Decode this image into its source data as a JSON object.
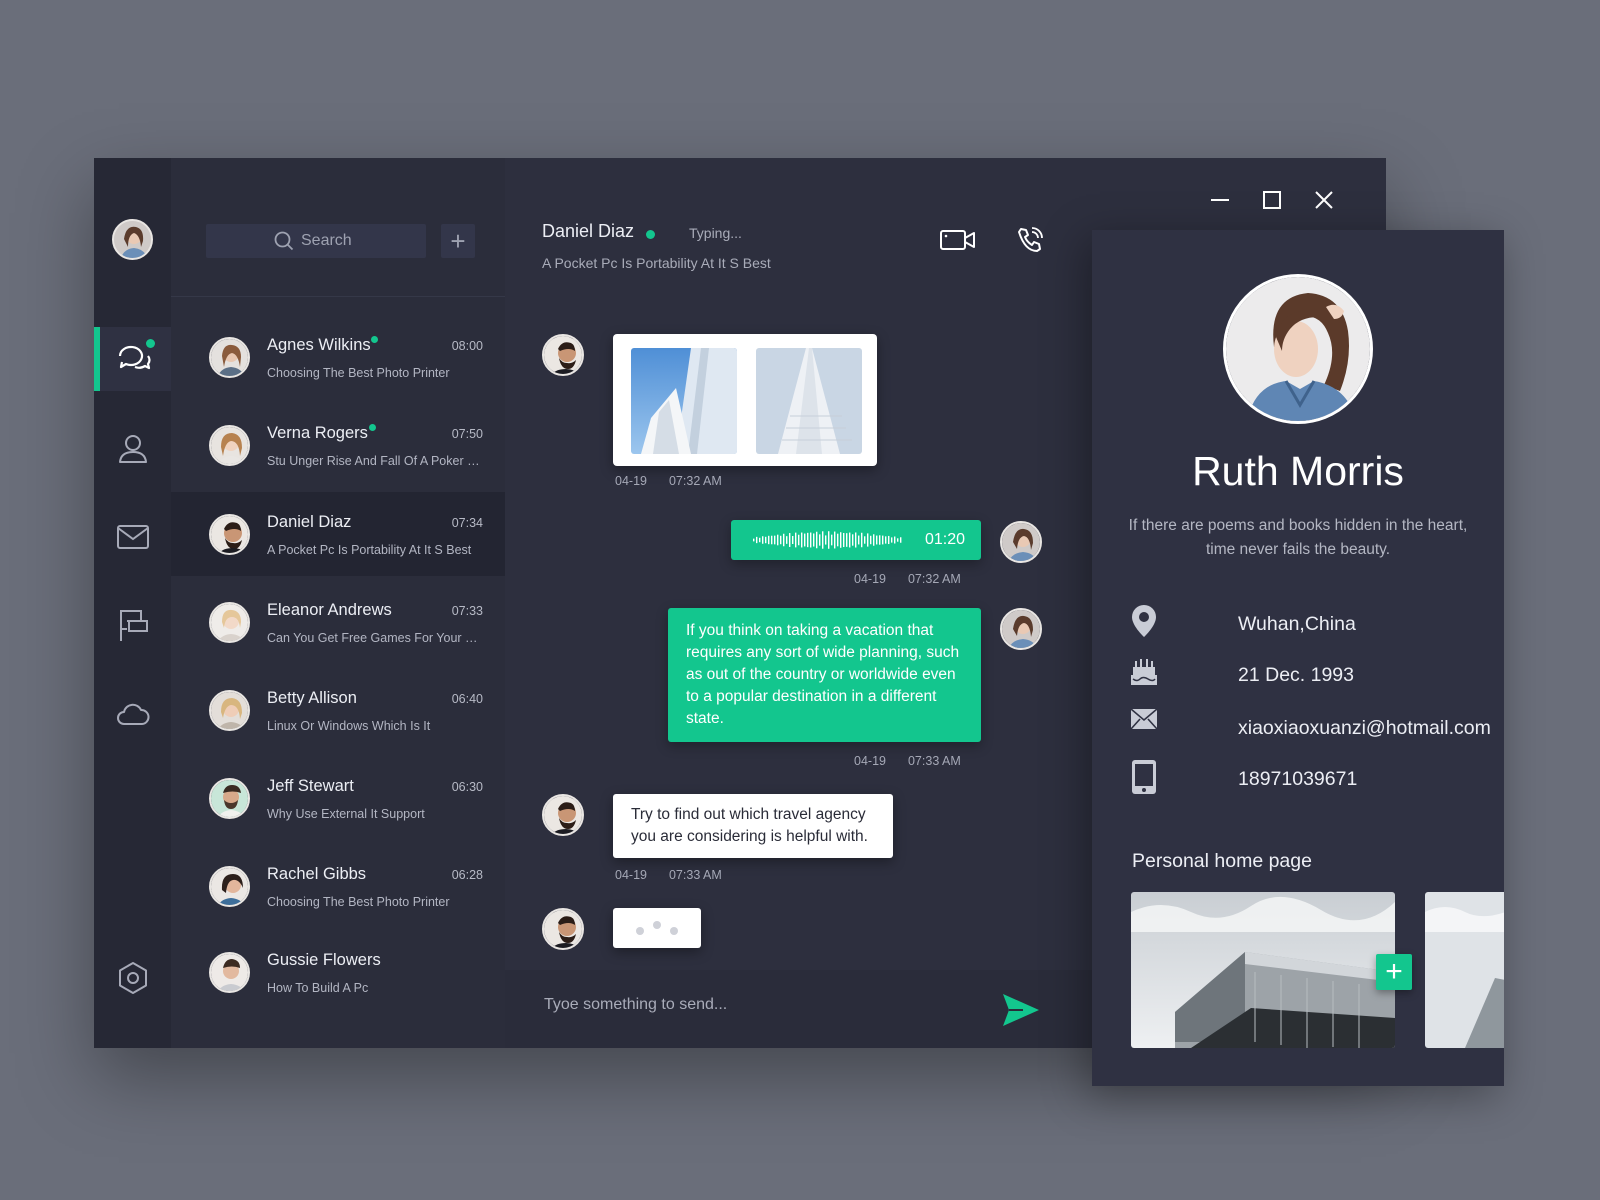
{
  "nav": {
    "items": [
      {
        "icon": "chat-bubbles-icon",
        "active": true,
        "has_badge": true
      },
      {
        "icon": "contacts-icon",
        "active": false
      },
      {
        "icon": "mail-icon",
        "active": false
      },
      {
        "icon": "flag-icon",
        "active": false
      },
      {
        "icon": "cloud-icon",
        "active": false
      }
    ],
    "settings_icon": "settings-hexagon-icon"
  },
  "search": {
    "placeholder": "Search"
  },
  "conversations": [
    {
      "name": "Agnes Wilkins",
      "time": "08:00",
      "preview": "Choosing The Best Photo Printer",
      "online": true,
      "avatar_color": "#c9b7a8"
    },
    {
      "name": "Verna Rogers",
      "time": "07:50",
      "preview": "Stu Unger Rise And Fall Of A Poker Playing Genius",
      "online": true,
      "avatar_color": "#d8c3b2"
    },
    {
      "name": "Daniel Diaz",
      "time": "07:34",
      "preview": "A Pocket Pc Is Portability At It S Best",
      "online": false,
      "active": true,
      "avatar_color": "#6a4a36"
    },
    {
      "name": "Eleanor Andrews",
      "time": "07:33",
      "preview": "Can You Get Free Games For Your Smartphone",
      "online": false,
      "avatar_color": "#e4d2c2"
    },
    {
      "name": "Betty Allison",
      "time": "06:40",
      "preview": "Linux Or Windows Which Is It",
      "online": false,
      "avatar_color": "#d5c0a4"
    },
    {
      "name": "Jeff Stewart",
      "time": "06:30",
      "preview": "Why Use External It Support",
      "online": false,
      "avatar_color": "#9e8a78"
    },
    {
      "name": "Rachel Gibbs",
      "time": "06:28",
      "preview": "Choosing The Best Photo Printer",
      "online": false,
      "avatar_color": "#4a3a36"
    },
    {
      "name": "Gussie Flowers",
      "time": "",
      "preview": "How To Build A Pc",
      "online": false,
      "avatar_color": "#a59384"
    }
  ],
  "chat": {
    "contact_name": "Daniel Diaz",
    "status": "Typing...",
    "subtitle": "A Pocket Pc Is Portability At It S Best",
    "messages": [
      {
        "kind": "images",
        "from": "contact",
        "date": "04-19",
        "time": "07:32  AM"
      },
      {
        "kind": "voice",
        "from": "me",
        "duration": "01:20",
        "date": "04-19",
        "time": "07:32  AM"
      },
      {
        "kind": "text",
        "from": "me",
        "text": "If you think on taking a vacation that requires any sort of wide planning, such as out of the country or worldwide even to a popular destination in a different state.",
        "date": "04-19",
        "time": "07:33  AM"
      },
      {
        "kind": "text",
        "from": "contact",
        "text": "Try to find out which travel agency you are considering is helpful with.",
        "date": "04-19",
        "time": "07:33  AM"
      },
      {
        "kind": "typing",
        "from": "contact"
      }
    ],
    "composer_placeholder": "Tyoe something to send..."
  },
  "profile": {
    "name": "Ruth Morris",
    "bio": "If there are poems and books hidden in the heart, time never fails the beauty.",
    "location": "Wuhan,China",
    "birthday": "21 Dec.  1993",
    "email": "xiaoxiaoxuanzi@hotmail.com",
    "phone": "18971039671",
    "home_title": "Personal home page"
  },
  "colors": {
    "accent": "#13c68e",
    "panel": "#2d2f3e",
    "rail": "#262835",
    "background": "#6a6e7a"
  }
}
